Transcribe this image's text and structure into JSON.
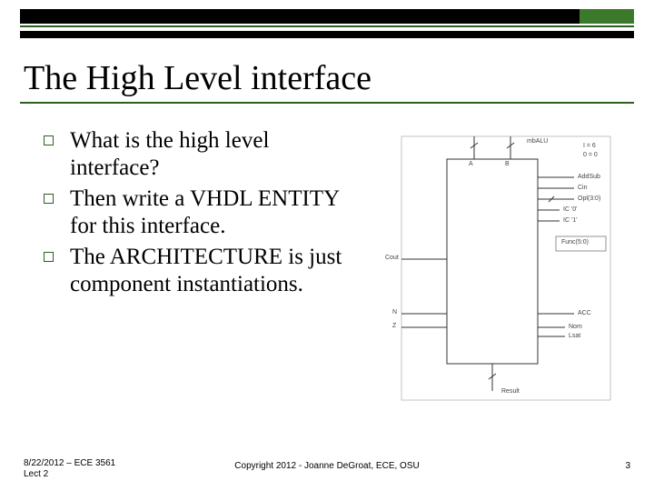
{
  "slide": {
    "title": "The High Level interface",
    "bullets": [
      "What is the high level interface?",
      "Then write a VHDL ENTITY for this interface.",
      "The ARCHITECTURE is just component instantiations."
    ]
  },
  "diagram": {
    "title": "mbALU",
    "ports": {
      "left": [
        "Cout",
        "N",
        "Z"
      ],
      "right_top": [
        "A",
        "B"
      ],
      "right": [
        "AddSub",
        "Cin",
        "Opl(3:0)",
        "IC '0'",
        "IC '1'"
      ],
      "right_mid": [
        "ACC",
        "Func(5:0)"
      ],
      "right_bot": [
        "Nom",
        "Lsat"
      ],
      "bottom": [
        "Result"
      ]
    },
    "bits": [
      "I = 6",
      "0 = 0"
    ]
  },
  "footer": {
    "left_line1": "8/22/2012 – ECE 3561",
    "left_line2": "Lect 2",
    "center": "Copyright 2012 - Joanne DeGroat, ECE, OSU",
    "page": "3"
  }
}
